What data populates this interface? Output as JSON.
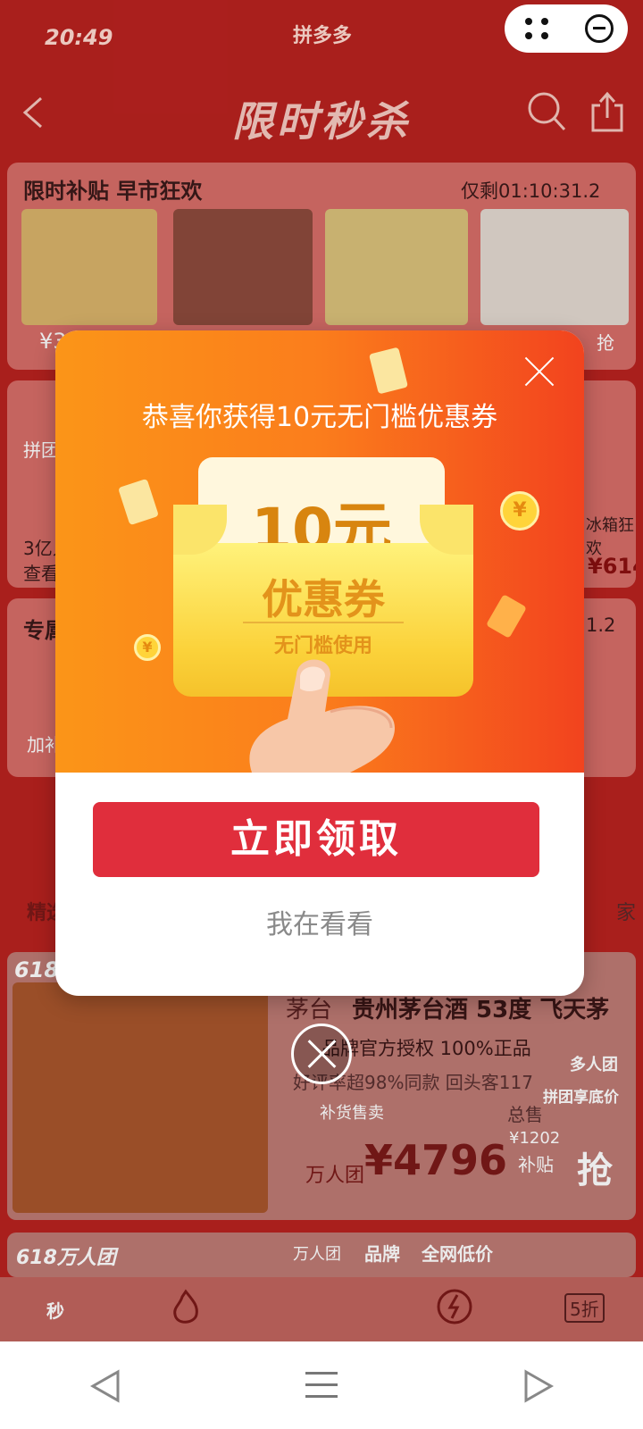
{
  "status_bar": {
    "time": "20:49",
    "app_name": "拼多多"
  },
  "nav": {
    "title": "限时秒杀"
  },
  "flash_card": {
    "title": "限时补贴  早市狂欢",
    "countdown": "仅剩01:10:31.2",
    "price_prefix": "¥3",
    "grab": "抢"
  },
  "group_card": {
    "line1": "拼团",
    "line2": "3亿人",
    "line3": "查看",
    "price": "¥614",
    "tag": "冰箱狂欢"
  },
  "exclusive_card": {
    "title": "专属",
    "countdown": "1.2",
    "button": "加补"
  },
  "tabs": {
    "first": "精选",
    "far_right": "家"
  },
  "product": {
    "badge": "618",
    "brand": "茅台",
    "name": "贵州茅台酒 53度 飞天茅",
    "auth": "品牌官方授权  100%正品",
    "stats": "好评率超98%同款  回头客117",
    "restock": "补货售卖",
    "sold": "总售",
    "price_label": "万人团",
    "price": "¥4796",
    "subsidy_amount": "¥1202",
    "subsidy_label": "补贴",
    "grab": "抢",
    "group_tag": "多人团",
    "group_sub": "拼团享底价"
  },
  "product2": {
    "badge": "618万人团",
    "tag1": "万人团",
    "tag2": "品牌",
    "tag3": "全网低价"
  },
  "bottom_nav": {
    "item1": "秒",
    "item5": "5折"
  },
  "modal": {
    "heading": "恭喜你获得10元无门槛优惠券",
    "amount": "10元",
    "type": "优惠券",
    "condition": "无门槛使用",
    "claim_button": "立即领取",
    "later_link": "我在看看",
    "coin_symbol": "¥"
  },
  "colors": {
    "page_bg": "#b8221f",
    "modal_gradient_start": "#fb9518",
    "modal_gradient_end": "#f2431e",
    "claim_button": "#e02e3c",
    "voucher_text": "#e3931b"
  }
}
